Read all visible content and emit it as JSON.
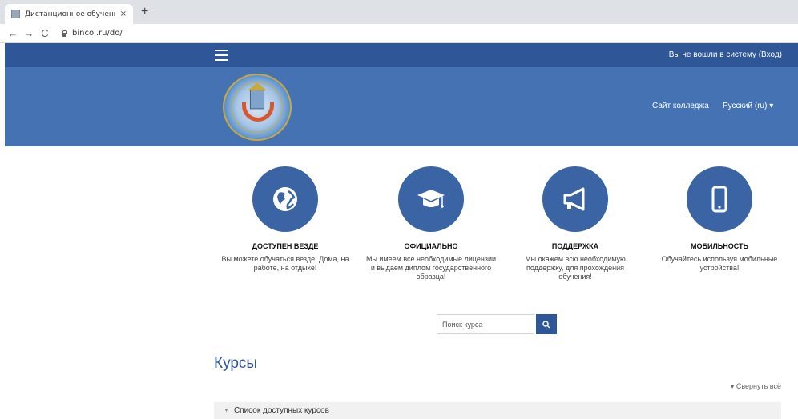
{
  "browser": {
    "tab_title": "Дистанционное обучение ОГАПОУ",
    "tab_close": "×",
    "new_tab": "+",
    "back": "←",
    "forward": "→",
    "reload": "C",
    "url": "bincol.ru/do/"
  },
  "navbar": {
    "login_text": "Вы не вошли в систему (Вход)"
  },
  "header": {
    "college_link": "Сайт колледжа",
    "language": "Русский (ru) ▾"
  },
  "features": [
    {
      "title": "ДОСТУПЕН ВЕЗДЕ",
      "text": "Вы можете обучаться везде: Дома, на работе, на отдыхе!",
      "icon": "globe-icon"
    },
    {
      "title": "ОФИЦИАЛЬНО",
      "text": "Мы имеем все необходимые лицензии и выдаем диплом государственного образца!",
      "icon": "graduation-cap-icon"
    },
    {
      "title": "ПОДДЕРЖКА",
      "text": "Мы окажем всю необходимую поддержку, для прохождения обучения!",
      "icon": "megaphone-icon"
    },
    {
      "title": "МОБИЛЬНОСТЬ",
      "text": "Обучайтесь используя мобильные устройства!",
      "icon": "mobile-icon"
    }
  ],
  "search": {
    "placeholder": "Поиск курса"
  },
  "courses": {
    "title": "Курсы",
    "collapse_all": "▾ Свернуть всё",
    "list_header": "Список доступных курсов",
    "caret": "▼"
  },
  "colors": {
    "navbar": "#2f5797",
    "header": "#4472b2",
    "accent": "#3a64a3"
  }
}
